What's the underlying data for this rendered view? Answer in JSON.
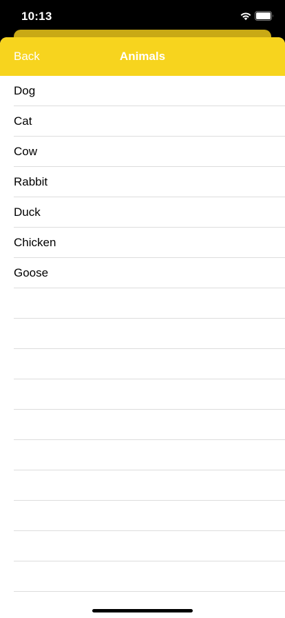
{
  "status_bar": {
    "time": "10:13",
    "icons": [
      "wifi-icon",
      "battery-icon"
    ]
  },
  "colors": {
    "nav_background": "#f7d41e",
    "nav_text": "#ffffff",
    "sheet_behind": "#c9a915",
    "separator": "#dcdcdc"
  },
  "nav": {
    "back_label": "Back",
    "title": "Animals"
  },
  "list": {
    "items": [
      {
        "label": "Dog"
      },
      {
        "label": "Cat"
      },
      {
        "label": "Cow"
      },
      {
        "label": "Rabbit"
      },
      {
        "label": "Duck"
      },
      {
        "label": "Chicken"
      },
      {
        "label": "Goose"
      },
      {
        "label": ""
      },
      {
        "label": ""
      },
      {
        "label": ""
      },
      {
        "label": ""
      },
      {
        "label": ""
      },
      {
        "label": ""
      },
      {
        "label": ""
      },
      {
        "label": ""
      },
      {
        "label": ""
      },
      {
        "label": ""
      },
      {
        "label": ""
      }
    ]
  }
}
